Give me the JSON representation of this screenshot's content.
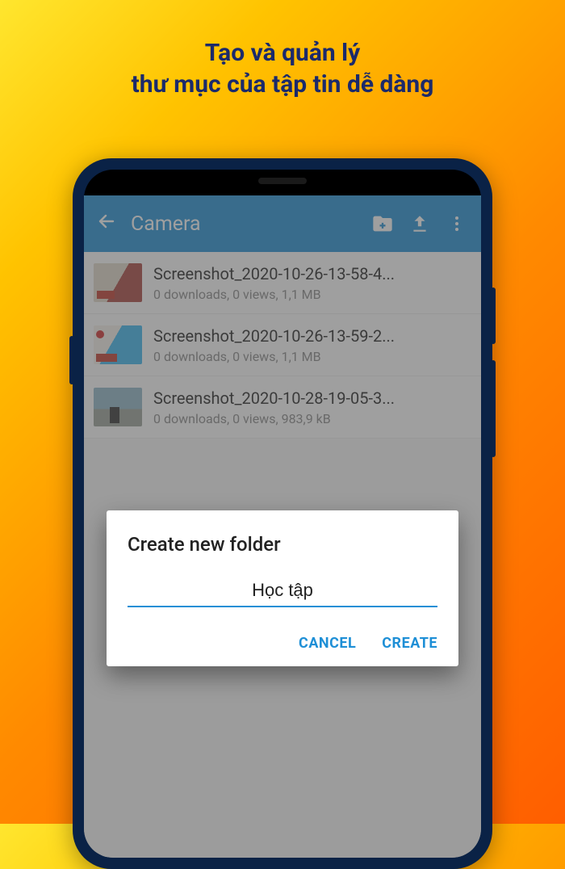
{
  "promo": {
    "line1": "Tạo và quản lý",
    "line2": "thư mục của tập tin dễ dàng"
  },
  "appbar": {
    "title": "Camera"
  },
  "files": [
    {
      "name": "Screenshot_2020-10-26-13-58-4...",
      "meta": "0 downloads, 0 views, 1,1 MB"
    },
    {
      "name": "Screenshot_2020-10-26-13-59-2...",
      "meta": "0 downloads, 0 views, 1,1 MB"
    },
    {
      "name": "Screenshot_2020-10-28-19-05-3...",
      "meta": "0 downloads, 0 views, 983,9 kB"
    }
  ],
  "dialog": {
    "title": "Create new folder",
    "input_value": "Học tập",
    "cancel": "CANCEL",
    "create": "CREATE"
  }
}
